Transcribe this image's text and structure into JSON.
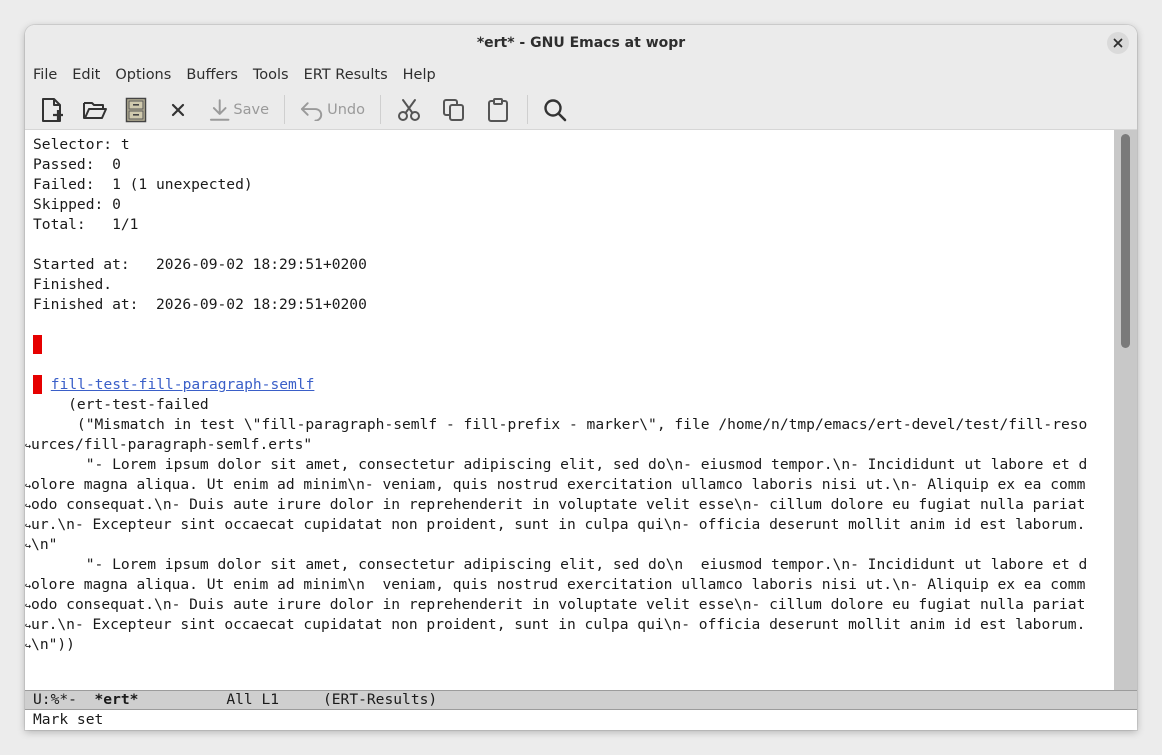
{
  "window": {
    "title": "*ert* - GNU Emacs at wopr"
  },
  "menu": [
    "File",
    "Edit",
    "Options",
    "Buffers",
    "Tools",
    "ERT Results",
    "Help"
  ],
  "toolbar": {
    "save_label": "Save",
    "undo_label": "Undo"
  },
  "buffer": {
    "selector": "Selector: t",
    "passed": "Passed:  0",
    "failed": "Failed:  1 (1 unexpected)",
    "skipped": "Skipped: 0",
    "total": "Total:   1/1",
    "started": "Started at:   2026-09-02 18:29:51+0200",
    "finished": "Finished.",
    "finished_at": "Finished at:  2026-09-02 18:29:51+0200",
    "badge": "F",
    "test_name": "fill-test-fill-paragraph-semlf",
    "lines": [
      "    (ert-test-failed",
      "     (\"Mismatch in test \\\"fill-paragraph-semlf - fill-prefix - marker\\\", file /home/n/tmp/emacs/ert-devel/test/fill-reso",
      "urces/fill-paragraph-semlf.erts\"",
      "      \"- Lorem ipsum dolor sit amet, consectetur adipiscing elit, sed do\\n- eiusmod tempor.\\n- Incididunt ut labore et d",
      "olore magna aliqua. Ut enim ad minim\\n- veniam, quis nostrud exercitation ullamco laboris nisi ut.\\n- Aliquip ex ea comm",
      "odo consequat.\\n- Duis aute irure dolor in reprehenderit in voluptate velit esse\\n- cillum dolore eu fugiat nulla pariat",
      "ur.\\n- Excepteur sint occaecat cupidatat non proident, sunt in culpa qui\\n- officia deserunt mollit anim id est laborum.",
      "\\n\"",
      "      \"- Lorem ipsum dolor sit amet, consectetur adipiscing elit, sed do\\n  eiusmod tempor.\\n- Incididunt ut labore et d",
      "olore magna aliqua. Ut enim ad minim\\n  veniam, quis nostrud exercitation ullamco laboris nisi ut.\\n- Aliquip ex ea comm",
      "odo consequat.\\n- Duis aute irure dolor in reprehenderit in voluptate velit esse\\n- cillum dolore eu fugiat nulla pariat",
      "ur.\\n- Excepteur sint occaecat cupidatat non proident, sunt in culpa qui\\n- officia deserunt mollit anim id est laborum.",
      "\\n\"))"
    ]
  },
  "modeline": {
    "status": "U:%*-  ",
    "buffer_name": "*ert*",
    "position": "          All L1     ",
    "mode": "(ERT-Results)"
  },
  "echo_area": "Mark set"
}
